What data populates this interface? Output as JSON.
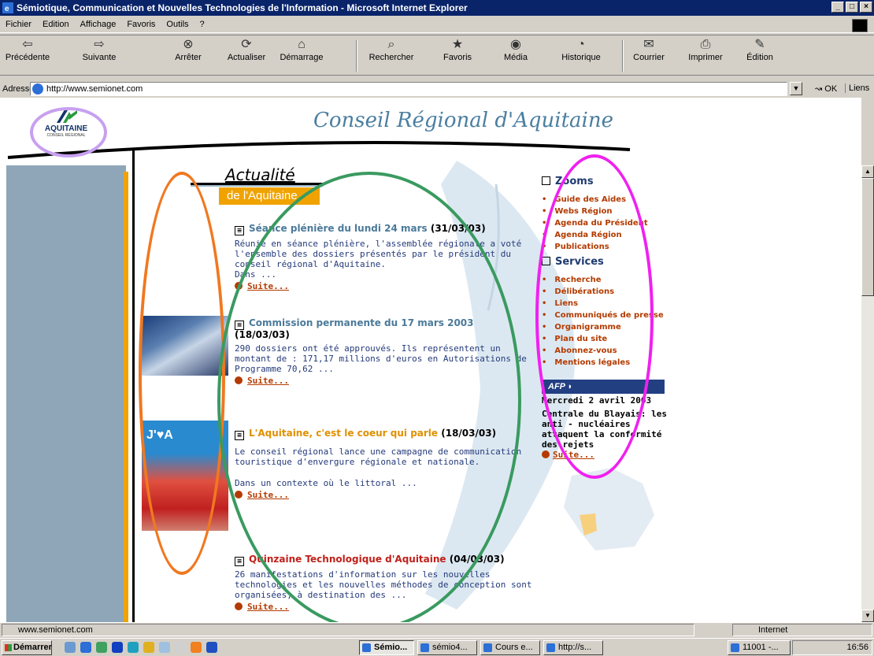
{
  "window": {
    "title": "Sémiotique, Communication et Nouvelles Technologies de l'Information - Microsoft Internet Explorer"
  },
  "menu": [
    "Fichier",
    "Edition",
    "Affichage",
    "Favoris",
    "Outils",
    "?"
  ],
  "toolbar": [
    "Précédente",
    "Suivante",
    "Arrêter",
    "Actualiser",
    "Démarrage",
    "Rechercher",
    "Favoris",
    "Média",
    "Historique",
    "Courrier",
    "Imprimer",
    "Édition"
  ],
  "address": {
    "label": "Adresse",
    "url": "http://www.semionet.com",
    "go": "OK",
    "links": "Liens"
  },
  "site": {
    "logo_text": "AQUITAINE",
    "logo_sub": "CONSEIL RÉGIONAL",
    "header_title": "Conseil Régional d'Aquitaine",
    "actu_title": "Actualité",
    "actu_sub": "de l'Aquitaine"
  },
  "news": [
    {
      "title": "Séance plénière du lundi 24 mars",
      "date": "(31/03/03)",
      "body": "Réunie en séance plénière, l'assemblée régionale a voté l'ensemble des dossiers présentés par le président du conseil régional d'Aquitaine.",
      "tail": "Dans ...",
      "more": "Suite..."
    },
    {
      "title": "Commission permanente du 17 mars 2003",
      "date": "(18/03/03)",
      "body": "290 dossiers ont été approuvés. Ils représentent un montant de : 171,17 millions d'euros en Autorisations de Programme 70,62 ...",
      "tail": "",
      "more": "Suite..."
    },
    {
      "title": "L'Aquitaine, c'est le coeur qui parle",
      "date": "(18/03/03)",
      "body": "Le conseil régional lance une campagne de communication touristique d'envergure régionale et nationale.",
      "tail": "Dans un contexte où le littoral ...",
      "more": "Suite..."
    },
    {
      "title": "Quinzaine Technologique d'Aquitaine",
      "date": "(04/03/03)",
      "body": "26 manifestations d'information sur les nouvelles technologies et les nouvelles méthodes de conception sont organisées, à destination des ...",
      "tail": "",
      "more": "Suite..."
    }
  ],
  "news_colors": [
    "#4b7a9a",
    "#4b7a9a",
    "#e09000",
    "#c0201a"
  ],
  "sidebar": {
    "zooms_title": "Zooms",
    "zooms": [
      "Guide des Aides",
      "Webs Région",
      "Agenda du Président",
      "Agenda Région",
      "Publications"
    ],
    "services_title": "Services",
    "services": [
      "Recherche",
      "Délibérations",
      "Liens",
      "Communiqués de presse",
      "Organigramme",
      "Plan du site",
      "Abonnez-vous",
      "Mentions légales"
    ]
  },
  "afp": {
    "badge": "AFP",
    "date": "Mercredi 2 avril 2003",
    "headline": "Centrale du Blayais: les anti - nucléaires attaquent la conformité des rejets",
    "more": "Suite..."
  },
  "status": {
    "url": "www.semionet.com",
    "zone": "Internet"
  },
  "taskbar": {
    "start": "Démarrer",
    "tasks": [
      "Sémio...",
      "sémio4...",
      "Cours e...",
      "http://s...",
      "11001 -..."
    ],
    "clock": "16:56"
  },
  "ellipse_colors": {
    "logo": "#c8a0f0",
    "thumbnails": "#f07820",
    "news": "#3a9a60",
    "sidebar": "#f020f0"
  },
  "colors": {
    "titlebar": "#0a246a",
    "orange": "#f0a300",
    "link": "#b33b00",
    "navy": "#223f82"
  }
}
